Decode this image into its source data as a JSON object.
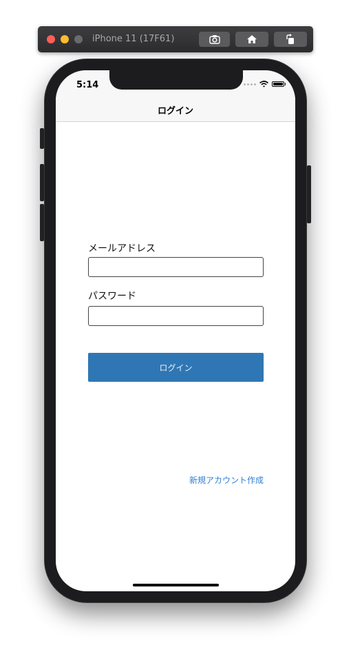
{
  "simulator": {
    "title": "iPhone 11 (17F61)",
    "buttons": [
      {
        "icon": "camera-icon"
      },
      {
        "icon": "home-icon"
      },
      {
        "icon": "rotate-icon"
      }
    ]
  },
  "status_bar": {
    "time": "5:14",
    "icons": [
      "signal-dots-icon",
      "wifi-icon",
      "battery-icon"
    ]
  },
  "nav": {
    "title": "ログイン"
  },
  "form": {
    "email_label": "メールアドレス",
    "email_value": "",
    "password_label": "パスワード",
    "password_value": "",
    "login_button": "ログイン",
    "signup_link": "新規アカウント作成"
  },
  "colors": {
    "primary_button": "#2f77b4",
    "link": "#2f7fd3",
    "nav_background": "#f7f7f7"
  }
}
